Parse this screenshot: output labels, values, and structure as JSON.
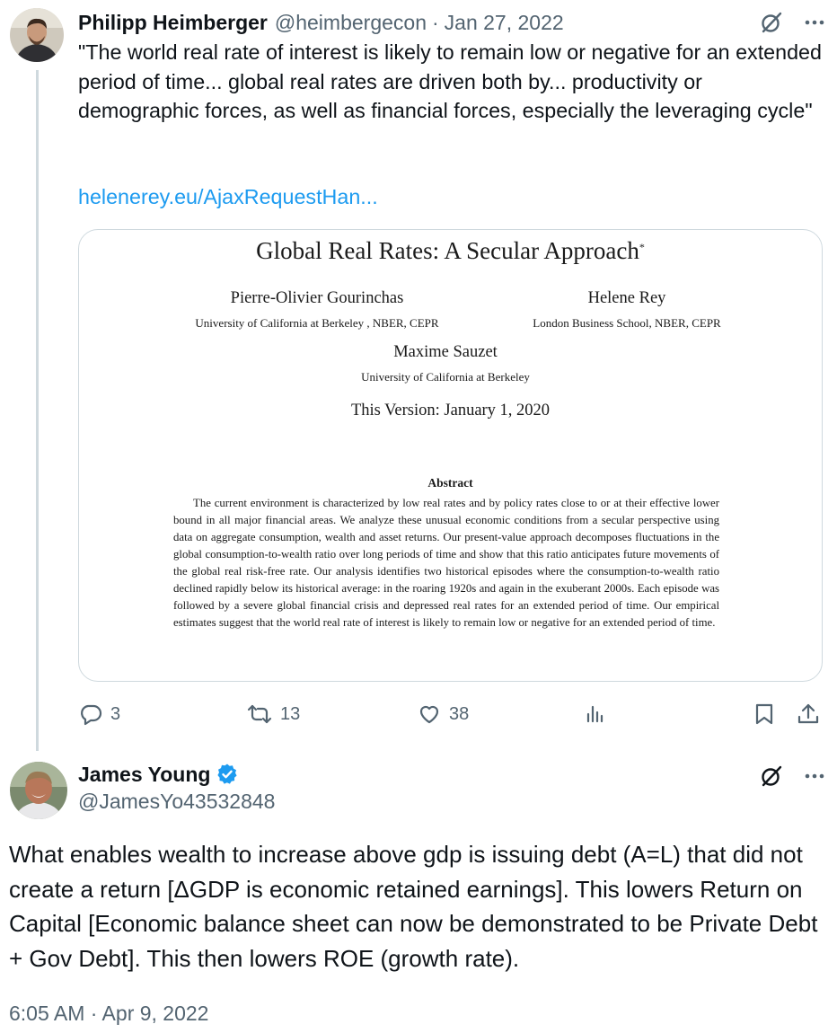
{
  "tweet1": {
    "author_name": "Philipp Heimberger",
    "author_handle": "@heimbergecon",
    "separator": "·",
    "date": "Jan 27, 2022",
    "text": "\"The world real rate of interest is likely to remain low or negative for an extended period of time... global real rates are driven both by... productivity or demographic forces, as well as financial forces, especially the leveraging cycle\"",
    "link": "helenerey.eu/AjaxRequestHan...",
    "card": {
      "title": "Global Real Rates: A Secular Approach",
      "title_mark": "*",
      "authors": [
        {
          "name": "Pierre-Olivier Gourinchas",
          "affiliation": "University of California at Berkeley , NBER, CEPR"
        },
        {
          "name": "Helene Rey",
          "affiliation": "London Business School, NBER, CEPR"
        },
        {
          "name": "Maxime Sauzet",
          "affiliation": "University of California at Berkeley"
        }
      ],
      "version": "This Version: January 1, 2020",
      "abstract_title": "Abstract",
      "abstract": "The current environment is characterized by low real rates and by policy rates close to or at their effective lower bound in all major financial areas. We analyze these unusual economic conditions from a secular perspective using data on aggregate consumption, wealth and asset returns. Our present-value approach decomposes fluctuations in the global consumption-to-wealth ratio over long periods of time and show that this ratio anticipates future movements of the global real risk-free rate. Our analysis identifies two historical episodes where the consumption-to-wealth ratio declined rapidly below its historical average: in the roaring 1920s and again in the exuberant 2000s. Each episode was followed by a severe global financial crisis and depressed real rates for an extended period of time. Our empirical estimates suggest that the world real rate of interest is likely to remain low or negative for an extended period of time."
    },
    "actions": {
      "replies": "3",
      "reposts": "13",
      "likes": "38"
    }
  },
  "tweet2": {
    "author_name": "James Young",
    "verified_badge": "verified-badge-icon",
    "author_handle": "@JamesYo43532848",
    "text": "What enables wealth to increase above gdp is issuing debt (A=L) that did not create a return [ΔGDP is economic retained earnings].  This lowers Return on Capital [Economic balance sheet can now be demonstrated to be Private Debt + Gov Debt].  This then lowers ROE (growth rate).",
    "timestamp": "6:05 AM · Apr 9, 2022"
  },
  "colors": {
    "text_primary": "#0f1419",
    "text_secondary": "#536471",
    "link": "#1d9bf0",
    "border": "#cfd9de",
    "verified": "#1d9bf0"
  }
}
